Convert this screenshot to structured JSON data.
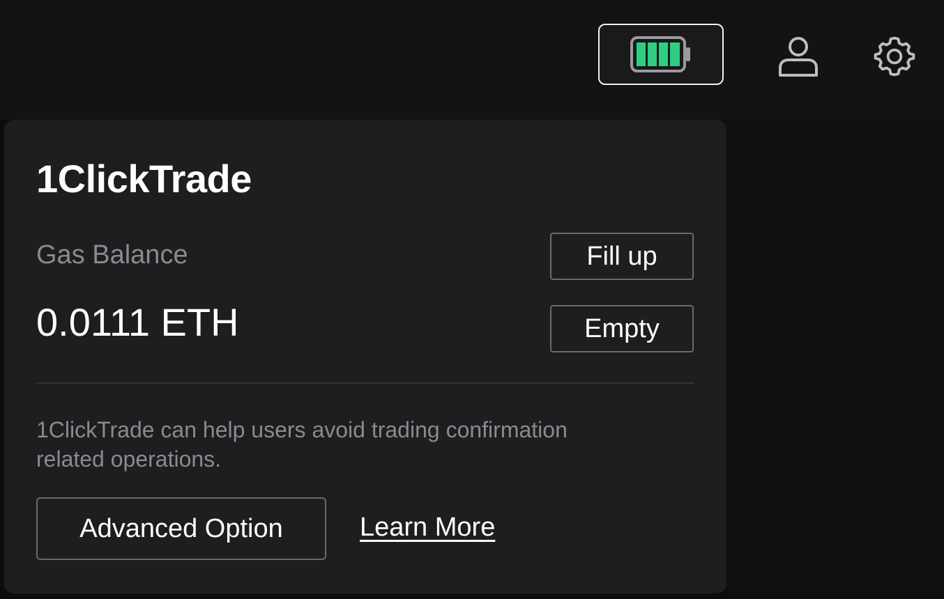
{
  "header": {
    "battery_icon": "battery-full-icon",
    "user_icon": "user-icon",
    "settings_icon": "gear-icon",
    "battery_color": "#2fce82"
  },
  "panel": {
    "title": "1ClickTrade",
    "gas_balance_label": "Gas Balance",
    "gas_balance_value": "0.0111 ETH",
    "fill_up_label": "Fill up",
    "empty_label": "Empty",
    "description_line1": "1ClickTrade can help users avoid trading confirmation",
    "description_line2": "related operations.",
    "advanced_option_label": "Advanced Option",
    "learn_more_label": "Learn More"
  }
}
